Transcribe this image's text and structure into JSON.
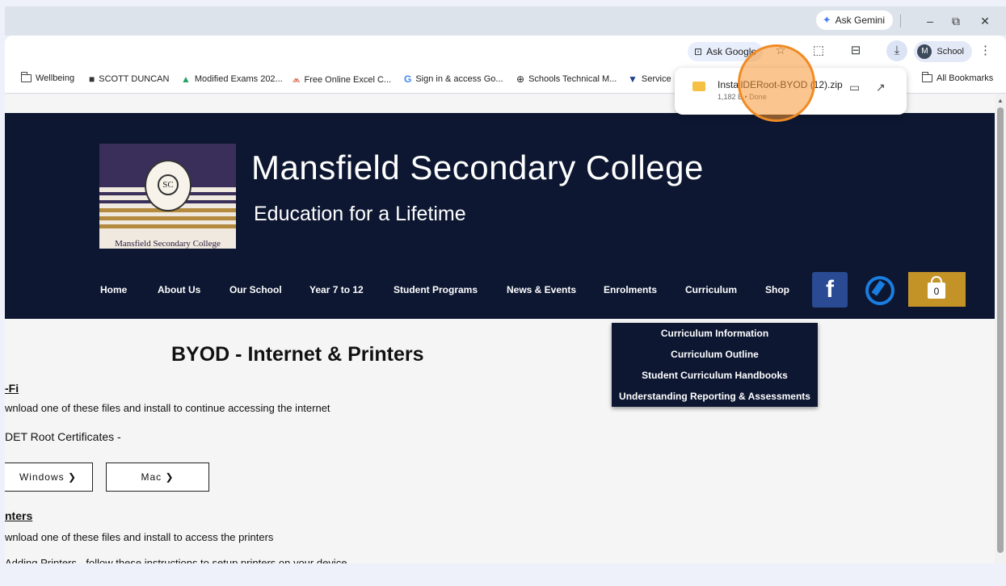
{
  "browser": {
    "ask_gemini": "Ask Gemini",
    "ask_google": "Ask Google",
    "profile_initial": "M",
    "profile_name": "School",
    "bookmarks": [
      {
        "label": "Wellbeing",
        "icon": "folder-icon"
      },
      {
        "label": "SCOTT DUNCAN",
        "icon": "cube-icon"
      },
      {
        "label": "Modified Exams 202...",
        "icon": "drive-icon"
      },
      {
        "label": "Free Online Excel C...",
        "icon": "excel-icon"
      },
      {
        "label": "Sign in & access Go...",
        "icon": "google-icon"
      },
      {
        "label": "Schools Technical M...",
        "icon": "globe-icon"
      },
      {
        "label": "Service",
        "icon": "vic-icon"
      },
      {
        "label": "All Bookmarks",
        "icon": "folder-icon"
      }
    ]
  },
  "download": {
    "filename": "InstallDERoot-BYOD (12).zip",
    "status": "1,182 B • Done"
  },
  "site": {
    "title": "Mansfield Secondary College",
    "tagline": "Education for a Lifetime",
    "logo_caption": "Mansfield Secondary College",
    "logo_seal_text": "SC",
    "nav": [
      "Home",
      "About Us",
      "Our School",
      "Year 7 to 12",
      "Student Programs",
      "News & Events",
      "Enrolments",
      "Curriculum",
      "Shop"
    ],
    "cart_count": "0",
    "curriculum_menu": [
      "Curriculum Information",
      "Curriculum Outline",
      "Student Curriculum Handbooks",
      "Understanding Reporting & Assessments"
    ]
  },
  "content": {
    "heading": "BYOD - Internet & Printers",
    "wifi_head": "-Fi",
    "wifi_text": "wnload one of these files and install to continue accessing the internet",
    "cert_head": "DET Root Certificates -",
    "btn_windows": "Windows ❯",
    "btn_mac": "Mac ❯",
    "printers_head": "nters",
    "printers_text": "wnload one of these files and install to access the printers",
    "adding_text": "Adding Printers - follow these instructions to setup printers on your device"
  }
}
